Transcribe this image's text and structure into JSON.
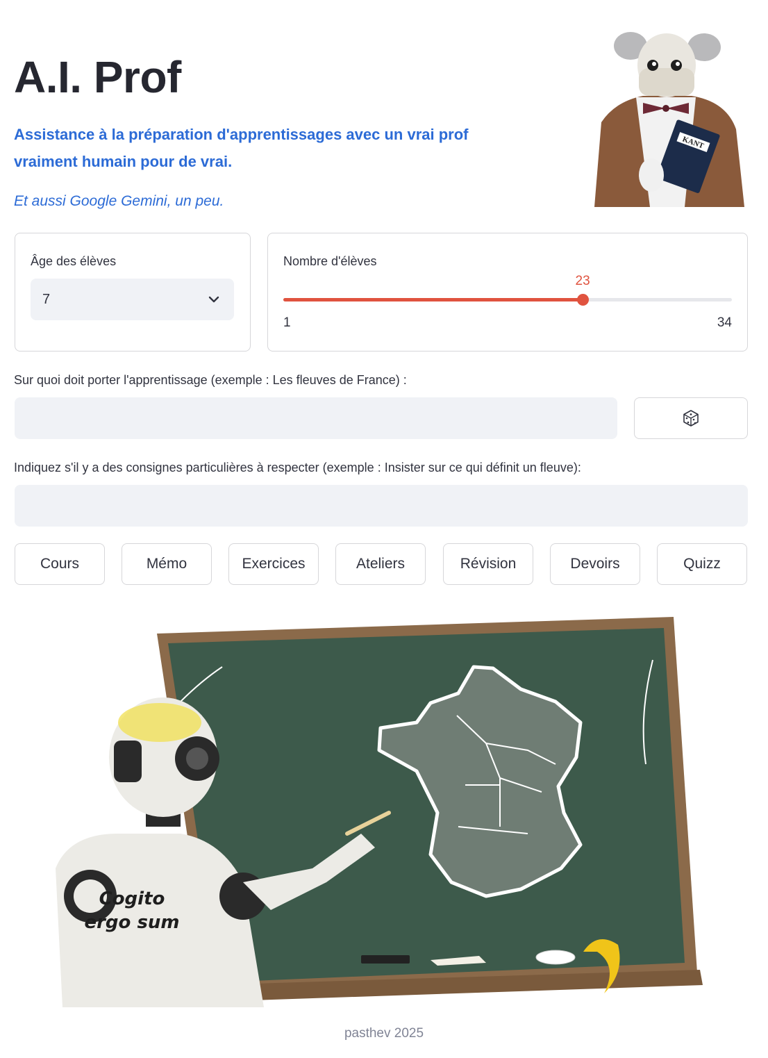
{
  "header": {
    "title": "A.I. Prof",
    "subtitle": "Assistance à la préparation d'apprentissages avec un vrai prof vraiment humain pour de vrai.",
    "note": "Et aussi Google Gemini, un peu.",
    "portrait_book_text": "KANT"
  },
  "age": {
    "label": "Âge des élèves",
    "selected": "7",
    "icon": "chevron-down-icon"
  },
  "count": {
    "label": "Nombre d'élèves",
    "value": 23,
    "value_text": "23",
    "min": 1,
    "max": 34,
    "min_text": "1",
    "max_text": "34",
    "accent": "#e0533f"
  },
  "topic": {
    "label": "Sur quoi doit porter l'apprentissage (exemple : Les fleuves de France) :",
    "value": "",
    "random_icon": "dice-icon"
  },
  "constraints": {
    "label": "Indiquez s'il y a des consignes particulières à respecter (exemple : Insister sur ce qui définit un fleuve):",
    "value": ""
  },
  "actions": [
    {
      "label": "Cours"
    },
    {
      "label": "Mémo"
    },
    {
      "label": "Exercices"
    },
    {
      "label": "Ateliers"
    },
    {
      "label": "Révision"
    },
    {
      "label": "Devoirs"
    },
    {
      "label": "Quizz"
    }
  ],
  "illustration": {
    "robot_text_line1": "Cogito",
    "robot_text_line2": "ergo sum"
  },
  "footer": {
    "text": "pasthev 2025"
  }
}
